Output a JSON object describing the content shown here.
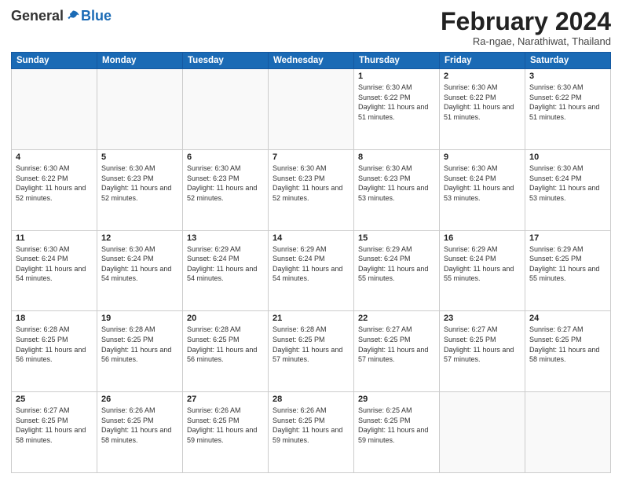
{
  "logo": {
    "general": "General",
    "blue": "Blue"
  },
  "header": {
    "month": "February 2024",
    "location": "Ra-ngae, Narathiwat, Thailand"
  },
  "weekdays": [
    "Sunday",
    "Monday",
    "Tuesday",
    "Wednesday",
    "Thursday",
    "Friday",
    "Saturday"
  ],
  "weeks": [
    [
      null,
      null,
      null,
      null,
      {
        "day": "1",
        "sunrise": "6:30 AM",
        "sunset": "6:22 PM",
        "daylight": "11 hours and 51 minutes."
      },
      {
        "day": "2",
        "sunrise": "6:30 AM",
        "sunset": "6:22 PM",
        "daylight": "11 hours and 51 minutes."
      },
      {
        "day": "3",
        "sunrise": "6:30 AM",
        "sunset": "6:22 PM",
        "daylight": "11 hours and 51 minutes."
      }
    ],
    [
      {
        "day": "4",
        "sunrise": "6:30 AM",
        "sunset": "6:22 PM",
        "daylight": "11 hours and 52 minutes."
      },
      {
        "day": "5",
        "sunrise": "6:30 AM",
        "sunset": "6:23 PM",
        "daylight": "11 hours and 52 minutes."
      },
      {
        "day": "6",
        "sunrise": "6:30 AM",
        "sunset": "6:23 PM",
        "daylight": "11 hours and 52 minutes."
      },
      {
        "day": "7",
        "sunrise": "6:30 AM",
        "sunset": "6:23 PM",
        "daylight": "11 hours and 52 minutes."
      },
      {
        "day": "8",
        "sunrise": "6:30 AM",
        "sunset": "6:23 PM",
        "daylight": "11 hours and 53 minutes."
      },
      {
        "day": "9",
        "sunrise": "6:30 AM",
        "sunset": "6:24 PM",
        "daylight": "11 hours and 53 minutes."
      },
      {
        "day": "10",
        "sunrise": "6:30 AM",
        "sunset": "6:24 PM",
        "daylight": "11 hours and 53 minutes."
      }
    ],
    [
      {
        "day": "11",
        "sunrise": "6:30 AM",
        "sunset": "6:24 PM",
        "daylight": "11 hours and 54 minutes."
      },
      {
        "day": "12",
        "sunrise": "6:30 AM",
        "sunset": "6:24 PM",
        "daylight": "11 hours and 54 minutes."
      },
      {
        "day": "13",
        "sunrise": "6:29 AM",
        "sunset": "6:24 PM",
        "daylight": "11 hours and 54 minutes."
      },
      {
        "day": "14",
        "sunrise": "6:29 AM",
        "sunset": "6:24 PM",
        "daylight": "11 hours and 54 minutes."
      },
      {
        "day": "15",
        "sunrise": "6:29 AM",
        "sunset": "6:24 PM",
        "daylight": "11 hours and 55 minutes."
      },
      {
        "day": "16",
        "sunrise": "6:29 AM",
        "sunset": "6:24 PM",
        "daylight": "11 hours and 55 minutes."
      },
      {
        "day": "17",
        "sunrise": "6:29 AM",
        "sunset": "6:25 PM",
        "daylight": "11 hours and 55 minutes."
      }
    ],
    [
      {
        "day": "18",
        "sunrise": "6:28 AM",
        "sunset": "6:25 PM",
        "daylight": "11 hours and 56 minutes."
      },
      {
        "day": "19",
        "sunrise": "6:28 AM",
        "sunset": "6:25 PM",
        "daylight": "11 hours and 56 minutes."
      },
      {
        "day": "20",
        "sunrise": "6:28 AM",
        "sunset": "6:25 PM",
        "daylight": "11 hours and 56 minutes."
      },
      {
        "day": "21",
        "sunrise": "6:28 AM",
        "sunset": "6:25 PM",
        "daylight": "11 hours and 57 minutes."
      },
      {
        "day": "22",
        "sunrise": "6:27 AM",
        "sunset": "6:25 PM",
        "daylight": "11 hours and 57 minutes."
      },
      {
        "day": "23",
        "sunrise": "6:27 AM",
        "sunset": "6:25 PM",
        "daylight": "11 hours and 57 minutes."
      },
      {
        "day": "24",
        "sunrise": "6:27 AM",
        "sunset": "6:25 PM",
        "daylight": "11 hours and 58 minutes."
      }
    ],
    [
      {
        "day": "25",
        "sunrise": "6:27 AM",
        "sunset": "6:25 PM",
        "daylight": "11 hours and 58 minutes."
      },
      {
        "day": "26",
        "sunrise": "6:26 AM",
        "sunset": "6:25 PM",
        "daylight": "11 hours and 58 minutes."
      },
      {
        "day": "27",
        "sunrise": "6:26 AM",
        "sunset": "6:25 PM",
        "daylight": "11 hours and 59 minutes."
      },
      {
        "day": "28",
        "sunrise": "6:26 AM",
        "sunset": "6:25 PM",
        "daylight": "11 hours and 59 minutes."
      },
      {
        "day": "29",
        "sunrise": "6:25 AM",
        "sunset": "6:25 PM",
        "daylight": "11 hours and 59 minutes."
      },
      null,
      null
    ]
  ]
}
